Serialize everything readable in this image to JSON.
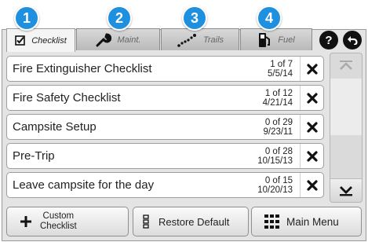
{
  "tabs": [
    {
      "badge": "1",
      "label": "Checklist",
      "icon": "checkbox-icon",
      "active": true
    },
    {
      "badge": "2",
      "label": "Maint.",
      "icon": "wrench-icon",
      "active": false
    },
    {
      "badge": "3",
      "label": "Trails",
      "icon": "dotted-trail-icon",
      "active": false
    },
    {
      "badge": "4",
      "label": "Fuel",
      "icon": "fuel-pump-icon",
      "active": false
    }
  ],
  "header_buttons": {
    "help": "?",
    "back_icon": "back-arrow-icon"
  },
  "checklists": [
    {
      "name": "Fire Extinguisher Checklist",
      "progress": "1 of 7",
      "date": "5/5/14"
    },
    {
      "name": "Fire Safety Checklist",
      "progress": "1 of 12",
      "date": "4/21/14"
    },
    {
      "name": "Campsite Setup",
      "progress": "0 of 29",
      "date": "9/23/11"
    },
    {
      "name": "Pre-Trip",
      "progress": "0 of 28",
      "date": "10/15/13"
    },
    {
      "name": "Leave campsite for the day",
      "progress": "0 of 15",
      "date": "10/20/13"
    }
  ],
  "bottom": {
    "custom_line1": "Custom",
    "custom_line2": "Checklist",
    "restore": "Restore Default",
    "menu": "Main Menu"
  },
  "colors": {
    "badge": "#1f8fdf",
    "delete": "#111111"
  }
}
